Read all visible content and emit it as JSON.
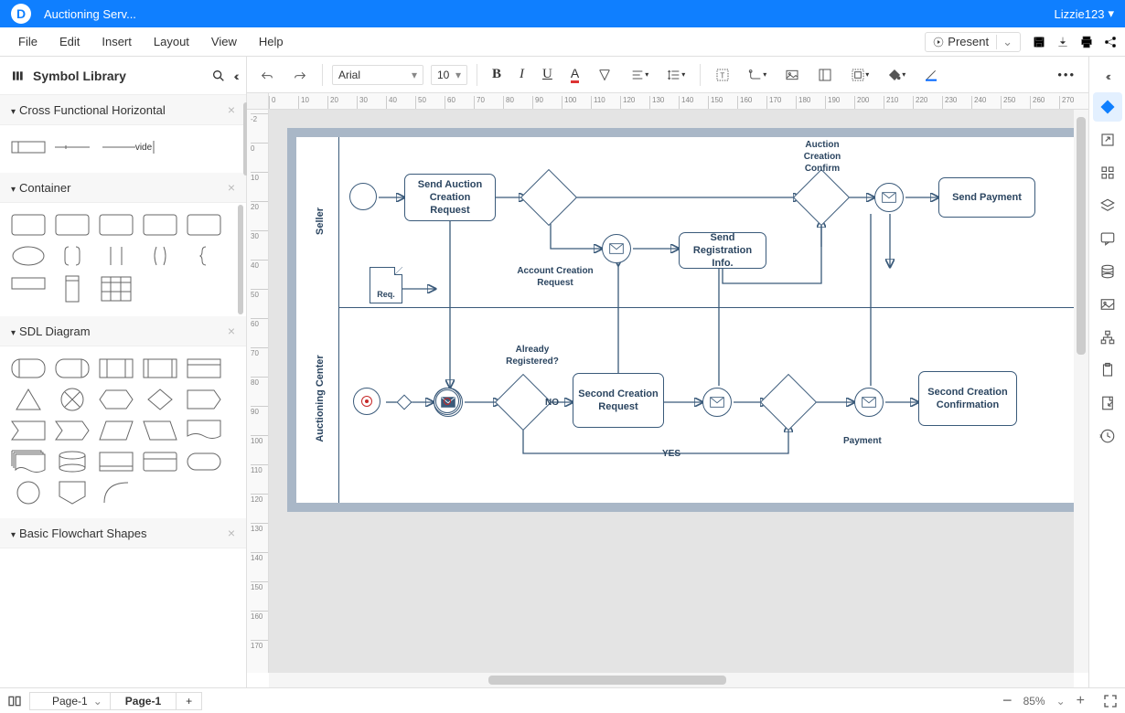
{
  "app": {
    "document_title": "Auctioning Serv...",
    "user_name": "Lizzie123"
  },
  "menu": {
    "file": "File",
    "edit": "Edit",
    "insert": "Insert",
    "layout": "Layout",
    "view": "View",
    "help": "Help",
    "present": "Present"
  },
  "sidebar": {
    "title": "Symbol Library",
    "sections": {
      "cross_functional": "Cross Functional Horizontal",
      "container": "Container",
      "sdl": "SDL Diagram",
      "basic": "Basic Flowchart Shapes"
    },
    "cross_vide": "vide"
  },
  "toolbar": {
    "font_name": "Arial",
    "font_size": "10"
  },
  "diagram": {
    "lanes": {
      "seller": "Seller",
      "center": "Auctioning Center"
    },
    "labels": {
      "send_auction": "Send Auction Creation Request",
      "auction_confirm": "Auction Creation Confirm",
      "send_payment": "Send Payment",
      "account_req": "Account Creation Request",
      "send_reg": "Send Registration Info.",
      "req": "Req.",
      "already": "Already Registered?",
      "second_req": "Second Creation Request",
      "second_conf": "Second Creation Confirmation",
      "payment": "Payment",
      "no": "NO",
      "yes": "YES"
    }
  },
  "status": {
    "page_select": "Page-1",
    "page_tab": "Page-1",
    "zoom_pct": "85%"
  }
}
